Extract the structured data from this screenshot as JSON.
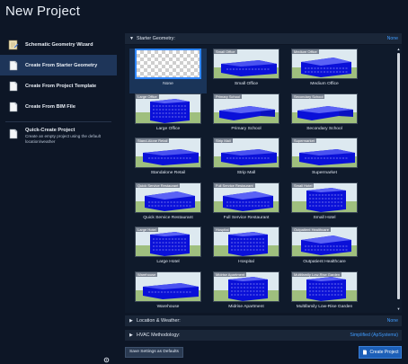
{
  "window": {
    "title": "New Project"
  },
  "sidebar": {
    "items": [
      {
        "label": "Schematic Geometry Wizard",
        "icon": "wizard-icon",
        "active": false
      },
      {
        "label": "Create From Starter Geometry",
        "icon": "page-icon",
        "active": true
      },
      {
        "label": "Create From Project Template",
        "icon": "page-icon",
        "active": false
      },
      {
        "label": "Create From BIM File",
        "icon": "page-icon",
        "active": false
      }
    ],
    "quick_create": {
      "label": "Quick-Create Project",
      "description": "Create an empty project using the default location/weather",
      "icon": "page-icon"
    }
  },
  "sections": {
    "starter": {
      "label": "Starter Geometry:",
      "value": "None",
      "chevron": "chevron-down-icon"
    },
    "location": {
      "label": "Location & Weather:",
      "value": "None",
      "chevron": "chevron-right-icon"
    },
    "hvac": {
      "label": "HVAC Methodology:",
      "value": "Simplified (ApSystems)",
      "chevron": "chevron-right-icon"
    }
  },
  "geometries": [
    {
      "name": "None",
      "label": "",
      "selected": true
    },
    {
      "name": "Small Office",
      "label": "Small Office"
    },
    {
      "name": "Medium Office",
      "label": "Medium Office"
    },
    {
      "name": "Large Office",
      "label": "Large Office"
    },
    {
      "name": "Primary School",
      "label": "Primary School"
    },
    {
      "name": "Secondary School",
      "label": "Secondary School"
    },
    {
      "name": "Standalone Retail",
      "label": "Stand-Alone Retail"
    },
    {
      "name": "Strip Mall",
      "label": "Strip Mall"
    },
    {
      "name": "Supermarket",
      "label": "Supermarket"
    },
    {
      "name": "Quick Service Restaurant",
      "label": "Quick Service Restaurant"
    },
    {
      "name": "Full Service Restaurant",
      "label": "Full Service Restaurant"
    },
    {
      "name": "Small Hotel",
      "label": "Small Hotel"
    },
    {
      "name": "Large Hotel",
      "label": "Large Hotel"
    },
    {
      "name": "Hospital",
      "label": "Hospital"
    },
    {
      "name": "Outpatient Healthcare",
      "label": "Outpatient Healthcare"
    },
    {
      "name": "Warehouse",
      "label": "Warehouse"
    },
    {
      "name": "Midrise Apartment",
      "label": "Midrise Apartment"
    },
    {
      "name": "Multifamily Low-Rise Garden",
      "label": "Multifamily Low-Rise Garden"
    }
  ],
  "footer": {
    "save_label": "Save Settings as Defaults",
    "create_label": "Create Project"
  },
  "colors": {
    "background": "#0d1626",
    "accent": "#2e86ff",
    "building": "#0a10d8",
    "sky": "#dde9f0",
    "grass": "#9fbf7e"
  }
}
